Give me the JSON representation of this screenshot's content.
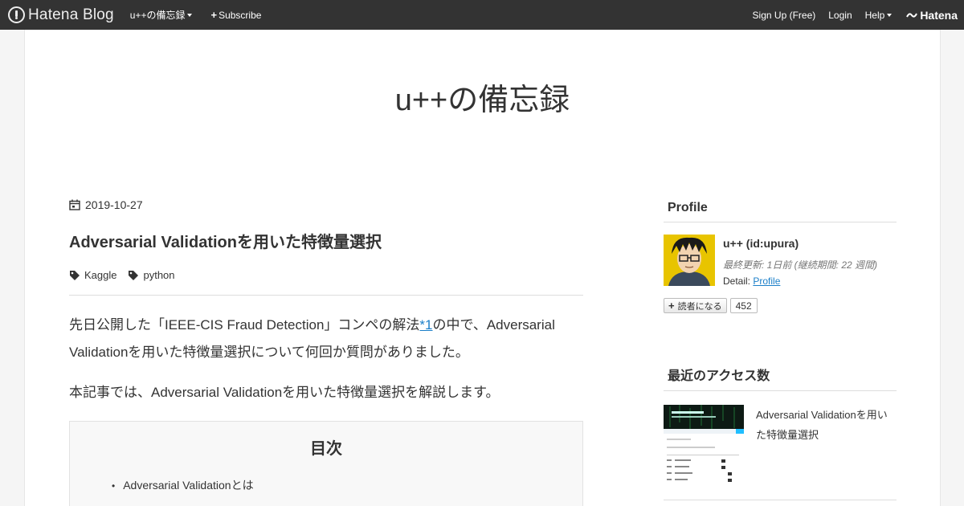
{
  "topbar": {
    "logo_text": "Hatena Blog",
    "blog_menu": "u++の備忘録",
    "subscribe": "Subscribe",
    "signup": "Sign Up (Free)",
    "login": "Login",
    "help": "Help",
    "brand": "Hatena"
  },
  "blog": {
    "title": "u++の備忘録"
  },
  "article": {
    "date": "2019-10-27",
    "title": "Adversarial Validationを用いた特徴量選択",
    "tags": [
      "Kaggle",
      "python"
    ],
    "para1_a": "先日公開した「IEEE-CIS Fraud Detection」コンペの解法",
    "para1_footnote": "*1",
    "para1_b": "の中で、Adversarial Validationを用いた特徴量選択について何回か質問がありました。",
    "para2": "本記事では、Adversarial Validationを用いた特徴量選択を解説します。",
    "toc": {
      "title": "目次",
      "items": [
        "Adversarial Validationとは"
      ]
    }
  },
  "sidebar": {
    "profile_heading": "Profile",
    "profile_name": "u++ (id:upura)",
    "profile_meta": "最終更新: 1日前 (継続期間: 22 週間)",
    "profile_detail_label": "Detail: ",
    "profile_detail_link": "Profile",
    "subscribe_button": "読者になる",
    "subscriber_count": "452",
    "access_heading": "最近のアクセス数",
    "access_item_title": "Adversarial Validationを用いた特徴量選択"
  },
  "colors": {
    "topbar_bg": "#333333",
    "link": "#1b7fc9",
    "avatar_bg": "#2d7bd6"
  }
}
